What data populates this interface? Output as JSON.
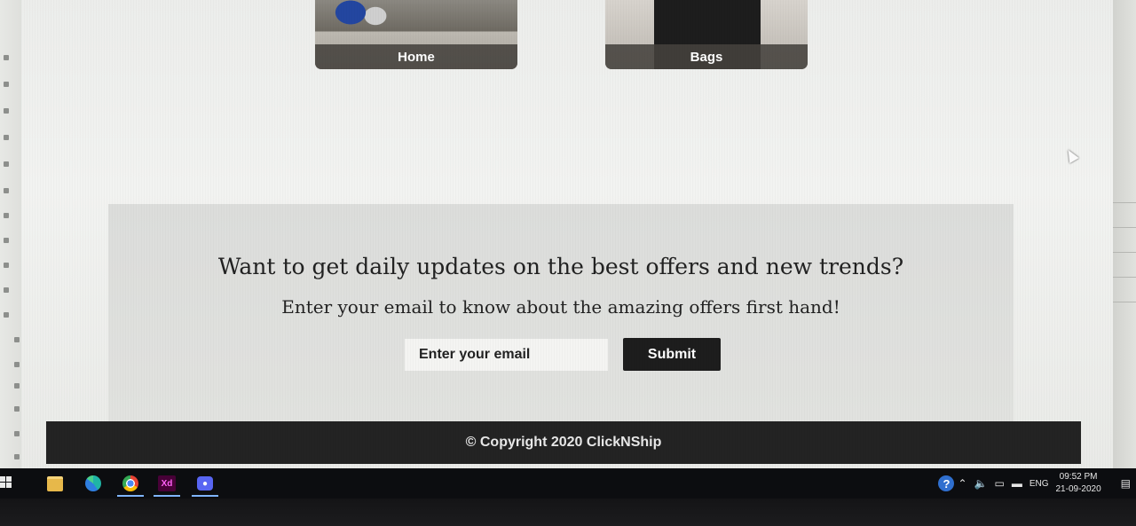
{
  "categories": [
    {
      "label": "Home"
    },
    {
      "label": "Bags"
    }
  ],
  "newsletter": {
    "heading": "Want to get daily updates on the best offers and new trends?",
    "subheading": "Enter your email to know about the amazing offers first hand!",
    "email_placeholder": "Enter your email",
    "submit_label": "Submit"
  },
  "footer": {
    "copyright": "© Copyright 2020 ClickNShip"
  },
  "taskbar": {
    "apps": [
      {
        "icon": "file-explorer-icon"
      },
      {
        "icon": "edge-icon"
      },
      {
        "icon": "chrome-icon",
        "glyph": ""
      },
      {
        "icon": "adobe-xd-icon",
        "glyph": "Xd"
      },
      {
        "icon": "discord-icon",
        "glyph": ""
      }
    ],
    "tray": {
      "language": "ENG",
      "time": "09:52 PM",
      "date": "21-09-2020"
    }
  }
}
